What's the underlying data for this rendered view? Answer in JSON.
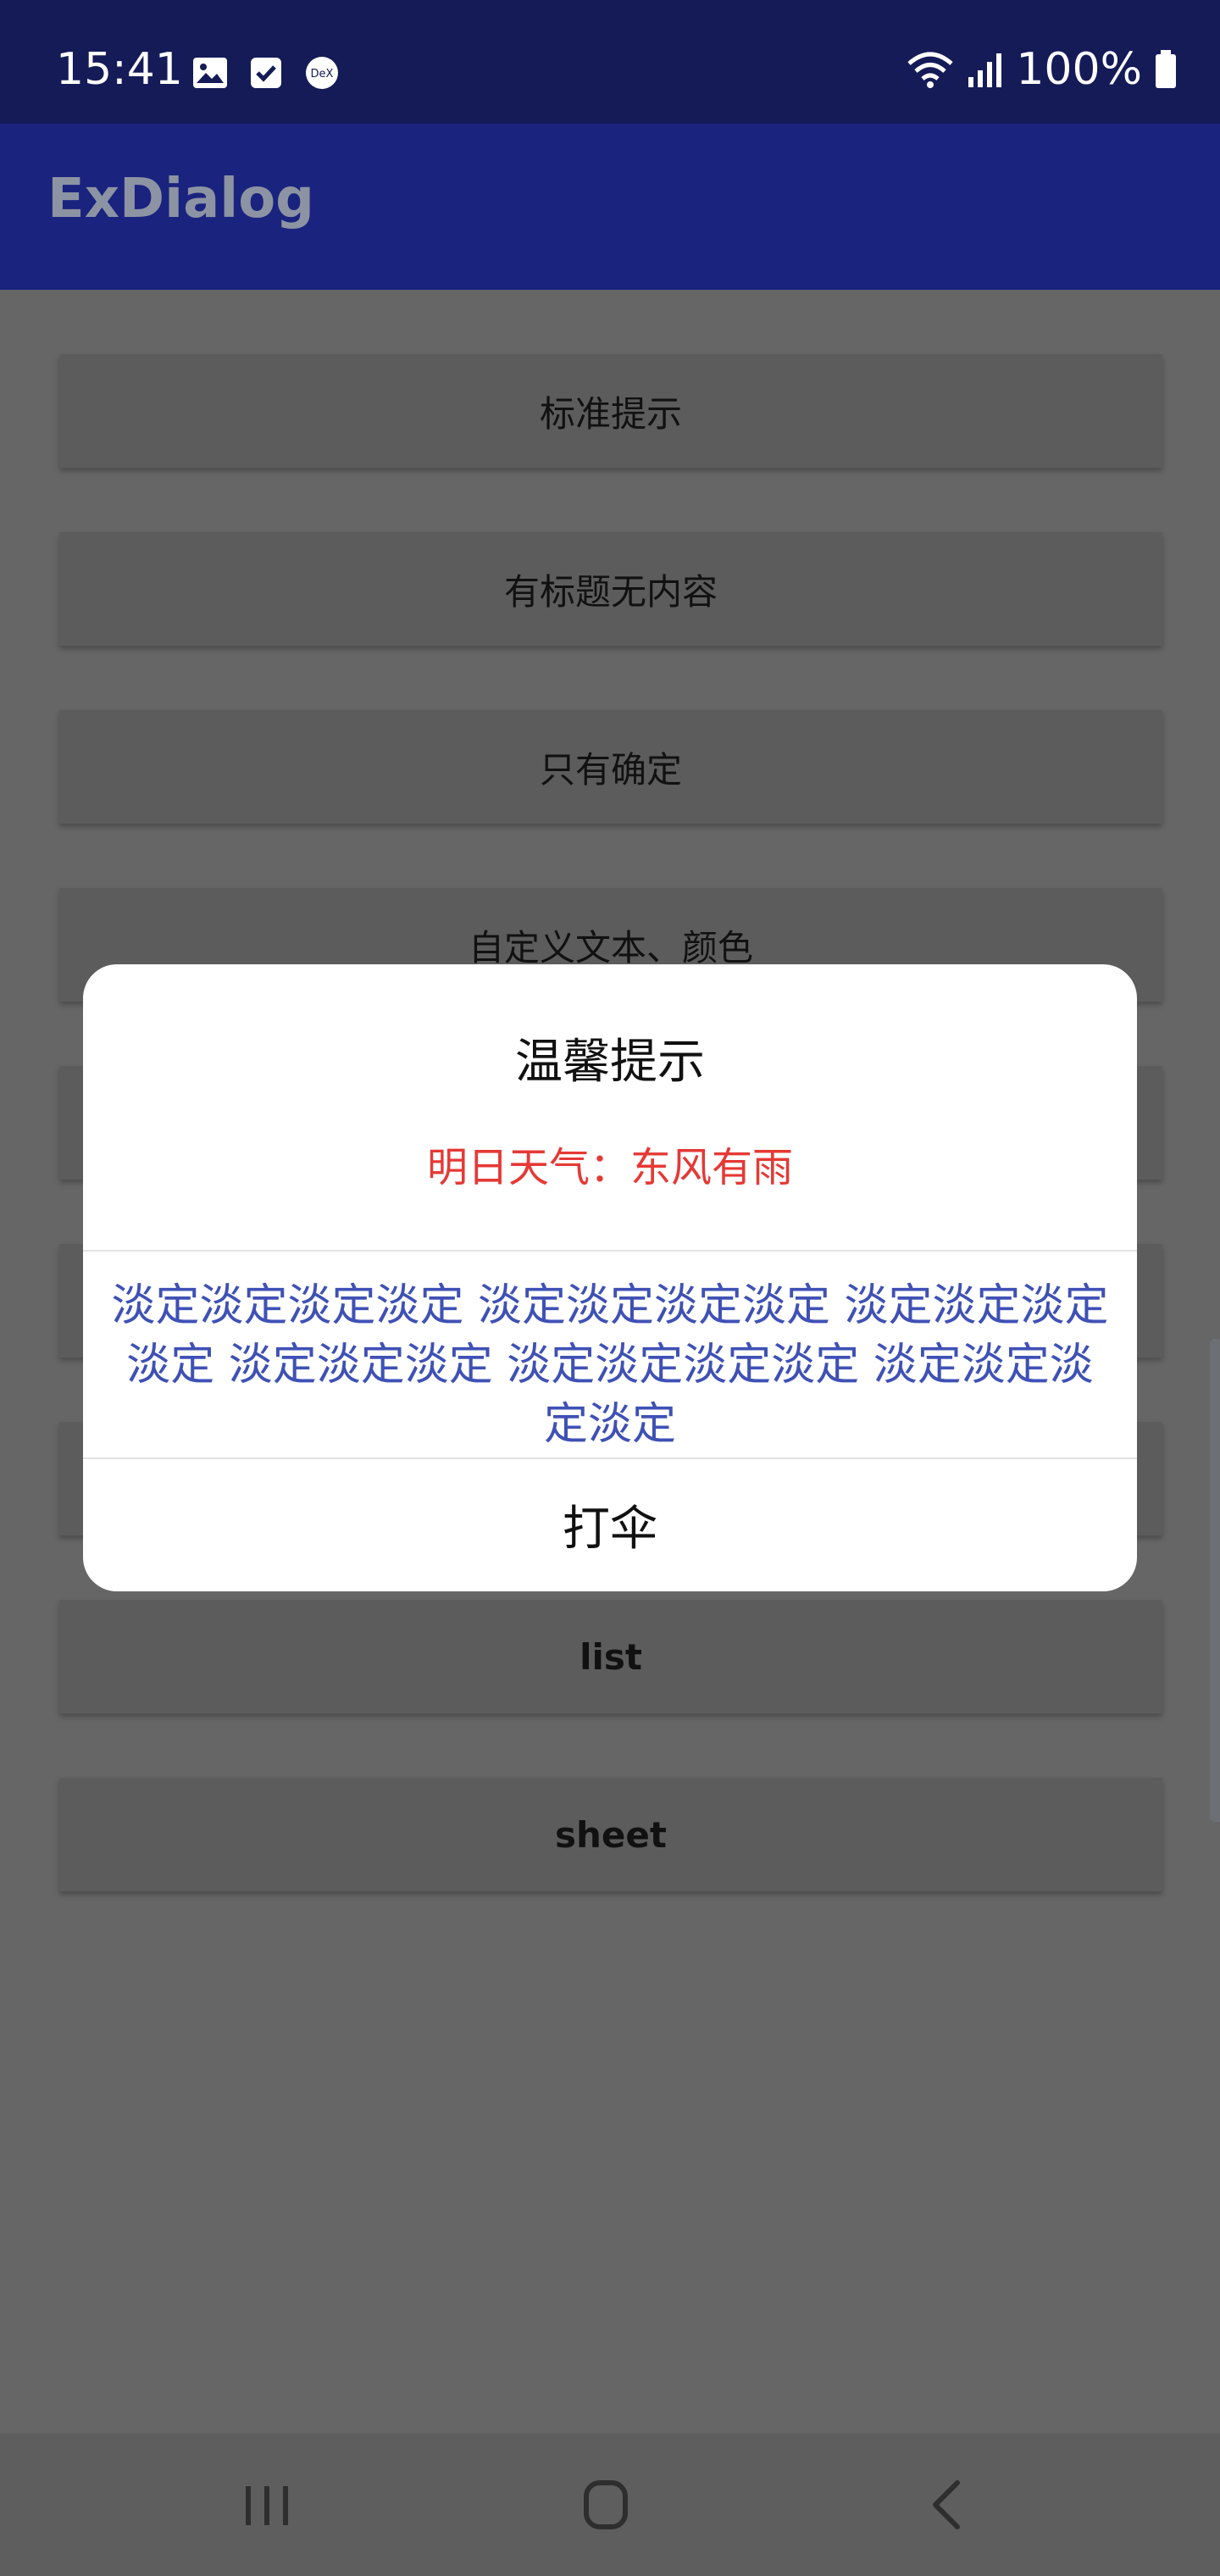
{
  "status_bar": {
    "time": "15:41",
    "battery": "100%",
    "icons": [
      "gallery-icon",
      "checkbox-icon",
      "dex-icon",
      "wifi-icon",
      "signal-icon",
      "battery-icon"
    ]
  },
  "app_bar": {
    "title": "ExDialog"
  },
  "buttons": [
    {
      "label": "标准提示"
    },
    {
      "label": "有标题无内容"
    },
    {
      "label": "只有确定"
    },
    {
      "label": "自定义文本、颜色"
    },
    {
      "label": ""
    },
    {
      "label": ""
    },
    {
      "label": ""
    },
    {
      "label": "list"
    },
    {
      "label": "sheet"
    }
  ],
  "dialog": {
    "title": "温馨提示",
    "message": "明日天气：东风有雨",
    "positive": "淡定淡定淡定淡定 淡定淡定淡定淡定 淡定淡定淡定淡定 淡定淡定淡定 淡定淡定淡定淡定 淡定淡定淡定淡定",
    "negative": "打伞"
  },
  "nav_bar": {
    "icons": [
      "recents-icon",
      "home-icon",
      "back-icon"
    ]
  },
  "colors": {
    "status_bar": "#141b57",
    "app_bar": "#1a237e",
    "dim_background": "#666666",
    "message_red": "#e53935",
    "positive_blue": "#3f51b5"
  }
}
